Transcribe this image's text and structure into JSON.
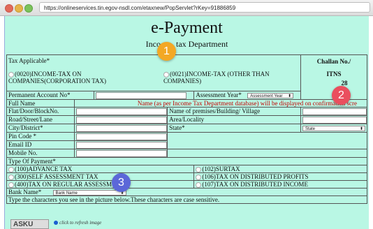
{
  "browser": {
    "url": "https://onlineservices.tin.egov-nsdl.com/etaxnew/PopServlet?rKey=91886859",
    "dot_colors": [
      "#e26a5a",
      "#e6b34a",
      "#7cc35b"
    ]
  },
  "header": {
    "title": "e-Payment",
    "subtitle_left": "Inco",
    "subtitle_right": "tax Department"
  },
  "tax_applicable": {
    "label": "Tax Applicable*",
    "option1": "(0020)INCOME-TAX ON COMPANIES(CORPORATION TAX)",
    "option2": "(0021)INCOME-TAX (OTHER THAN COMPANIES)"
  },
  "challan": {
    "label": "Challan No./",
    "itns": "ITNS",
    "number": "28"
  },
  "pan": {
    "label": "Permanent Account No*",
    "assessment_label": "Assessment Year*",
    "assessment_select": "Assessment Year"
  },
  "full_name": {
    "label": "Full Name",
    "note": "Name (as per Income Tax Department database) will be displayed on confirmation scre"
  },
  "address": {
    "flat": "Flat/Door/BlockNo.",
    "premises": "Name of premises/Building/ Village",
    "road": "Road/Street/Lane",
    "area": "Area/Locality",
    "city": "City/District*",
    "state": "State*",
    "state_select": "State",
    "pin": "Pin Code *",
    "email": "Email ID",
    "mobile": "Mobile No."
  },
  "payment": {
    "label": "Type Of Payment*",
    "opt100": "(100)ADVANCE TAX",
    "opt102": "(102)SURTAX",
    "opt300": "(300)SELF ASSESSMENT TAX",
    "opt106": "(106)TAX ON DISTRIBUTED PROFITS",
    "opt400": "(400)TAX ON REGULAR ASSESSM",
    "opt107": "(107)TAX ON DISTRIBUTED INCOME"
  },
  "bank": {
    "label": "Bank Name*",
    "select": "Bank Name"
  },
  "captcha": {
    "instruction": "Type the characters you see in the picture below.These characters are case sensitive.",
    "image_text": "ASKU",
    "refresh": "click to refresh image"
  },
  "badges": {
    "b1": "1",
    "b2": "2",
    "b3": "3",
    "b1_color": "#f3a825",
    "b2_color": "#ea4f5e",
    "b3_color": "#5b67d8"
  }
}
